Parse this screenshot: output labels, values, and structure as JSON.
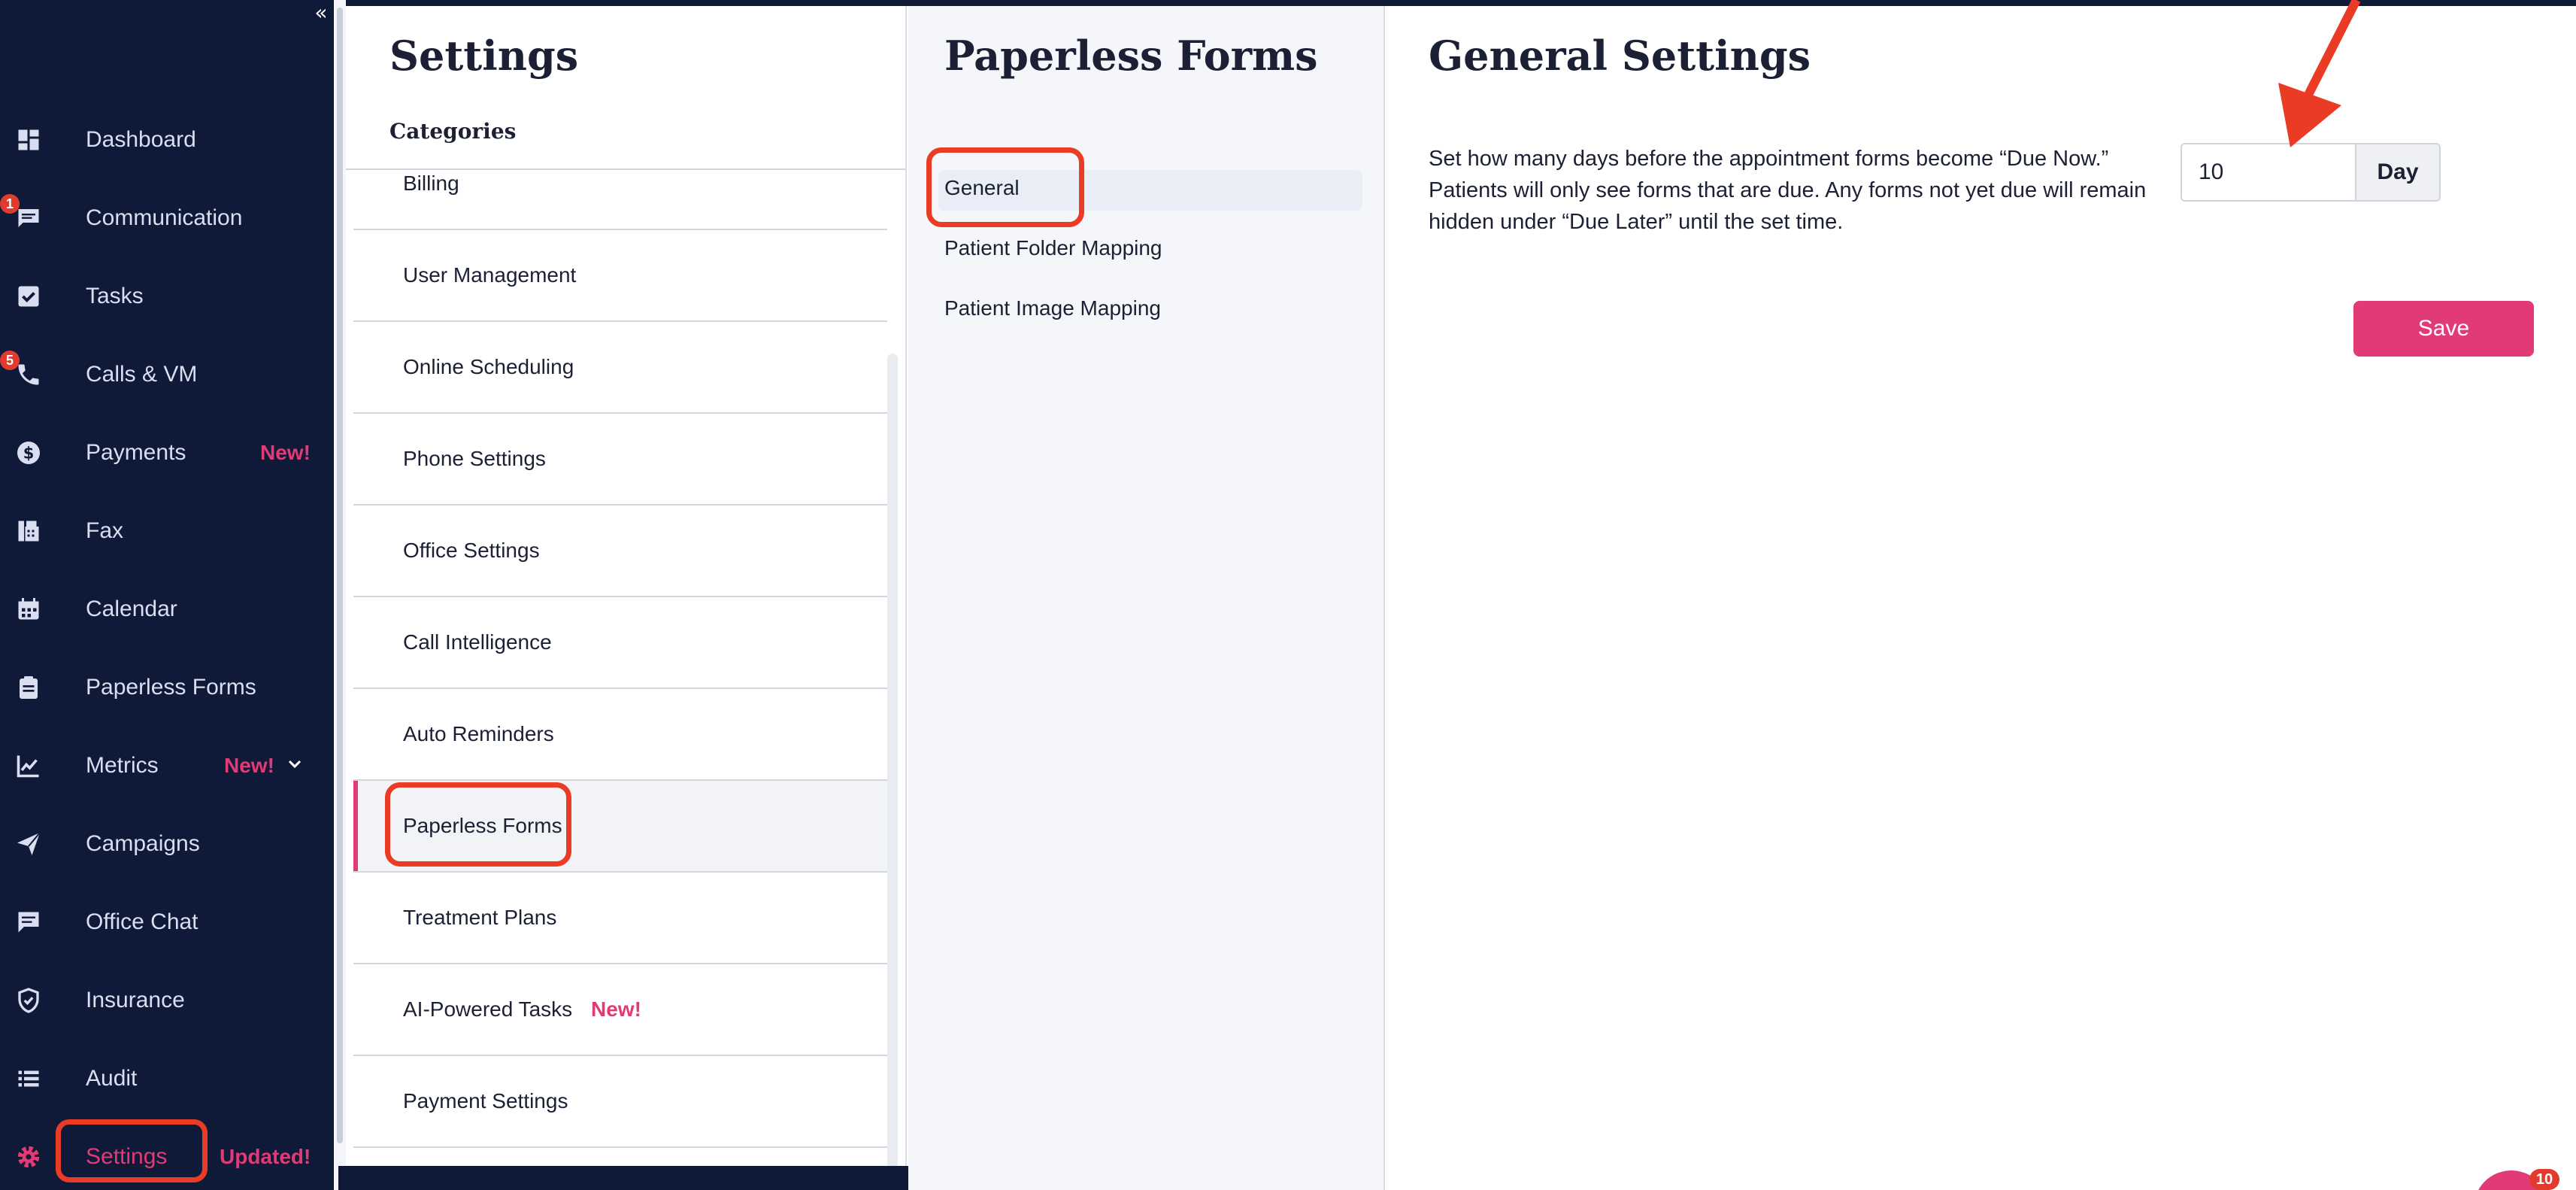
{
  "sidebar": {
    "collapse_glyph": "«",
    "items": [
      {
        "label": "Dashboard",
        "icon": "dashboard-icon"
      },
      {
        "label": "Communication",
        "icon": "chat-icon",
        "badge": "1"
      },
      {
        "label": "Tasks",
        "icon": "checkbox-icon"
      },
      {
        "label": "Calls & VM",
        "icon": "phone-icon",
        "badge": "5"
      },
      {
        "label": "Payments",
        "icon": "dollar-icon",
        "tag": "New!"
      },
      {
        "label": "Fax",
        "icon": "fax-icon"
      },
      {
        "label": "Calendar",
        "icon": "calendar-icon"
      },
      {
        "label": "Paperless Forms",
        "icon": "clipboard-icon"
      },
      {
        "label": "Metrics",
        "icon": "chart-icon",
        "tag": "New!"
      },
      {
        "label": "Campaigns",
        "icon": "paper-plane-icon"
      },
      {
        "label": "Office Chat",
        "icon": "chat-bubble-icon"
      },
      {
        "label": "Insurance",
        "icon": "shield-icon"
      },
      {
        "label": "Audit",
        "icon": "list-icon"
      },
      {
        "label": "Settings",
        "icon": "gear-icon",
        "tag": "Updated!"
      }
    ]
  },
  "categories": {
    "title": "Settings",
    "subtitle": "Categories",
    "items": [
      {
        "label": "Billing"
      },
      {
        "label": "User Management"
      },
      {
        "label": "Online Scheduling"
      },
      {
        "label": "Phone Settings"
      },
      {
        "label": "Office Settings"
      },
      {
        "label": "Call Intelligence"
      },
      {
        "label": "Auto Reminders"
      },
      {
        "label": "Paperless Forms"
      },
      {
        "label": "Treatment Plans"
      },
      {
        "label": "AI-Powered Tasks",
        "tag": "New!"
      },
      {
        "label": "Payment Settings"
      }
    ]
  },
  "paperless_forms": {
    "title": "Paperless Forms",
    "items": [
      {
        "label": "General"
      },
      {
        "label": "Patient Folder Mapping"
      },
      {
        "label": "Patient Image Mapping"
      }
    ]
  },
  "general_settings": {
    "title": "General Settings",
    "description": "Set how many days before the appointment forms become “Due Now.” Patients will only see forms that are due. Any forms not yet due will remain hidden under “Due Later” until the set time.",
    "days_value": "10",
    "unit_label": "Day",
    "save_label": "Save"
  },
  "chat_widget": {
    "count": "10"
  },
  "colors": {
    "sidebar_bg": "#0f1a38",
    "accent": "#e23a76",
    "highlight": "#ea3b24"
  }
}
